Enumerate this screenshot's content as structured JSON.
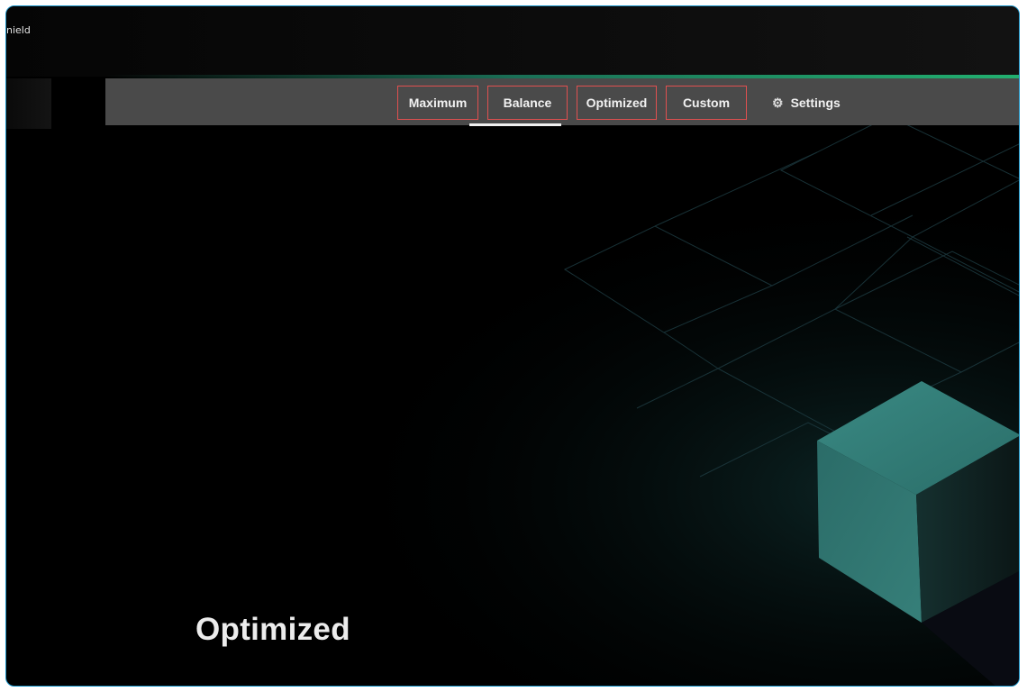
{
  "window": {
    "title_fragment": "nield"
  },
  "nav": {
    "tabs": [
      {
        "label": "Maximum"
      },
      {
        "label": "Balance"
      },
      {
        "label": "Optimized"
      },
      {
        "label": "Custom"
      }
    ],
    "active_tab": "Optimized",
    "settings_label": "Settings"
  },
  "hero": {
    "title": "Optimized"
  },
  "colors": {
    "window_border": "#1d95c8",
    "accent_green": "#22b070",
    "navbar_bg": "#4a4a4a",
    "tab_outline": "#e05050",
    "cube_teal": "#2f7f7a"
  },
  "icons": {
    "settings": "gear-icon"
  }
}
